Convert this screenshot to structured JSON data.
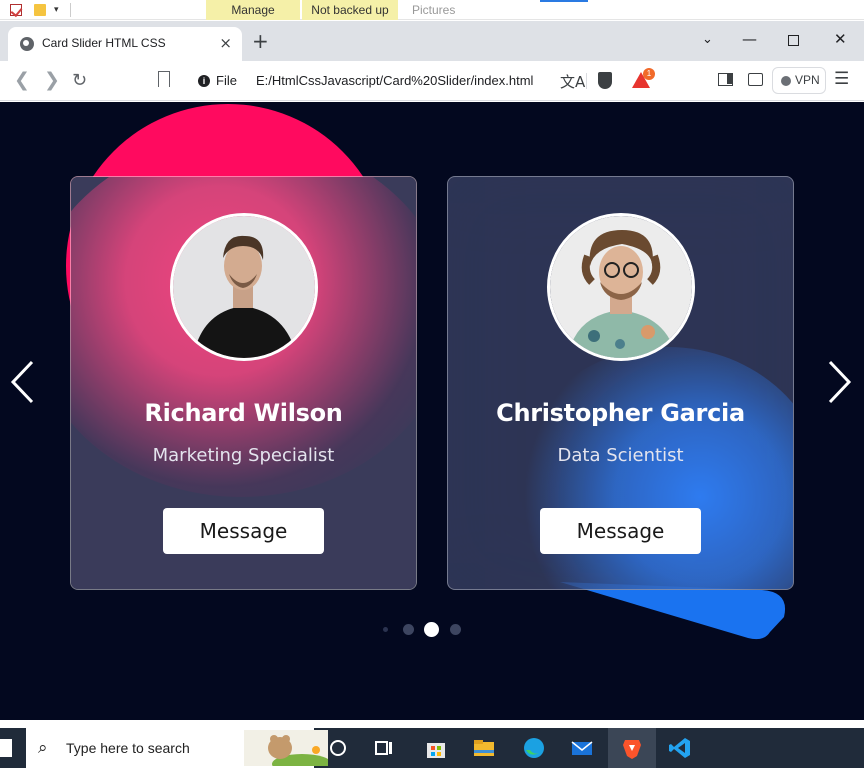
{
  "explorer": {
    "manage_tab": "Manage",
    "not_backed_up_tab": "Not backed up",
    "pictures_label": "Pictures"
  },
  "browser": {
    "tab_title": "Card Slider HTML CSS",
    "tab_close": "×",
    "new_tab": "+",
    "address_scheme_label": "File",
    "address_url": "E:/HtmlCssJavascript/Card%20Slider/index.html",
    "rewards_badge": "1",
    "vpn_label": "VPN",
    "icons": [
      "globe-icon",
      "close-icon",
      "plus-icon",
      "chevron-down-icon",
      "minimize-icon",
      "maximize-icon",
      "back-icon",
      "forward-icon",
      "reload-icon",
      "bookmark-icon",
      "info-icon",
      "translate-icon",
      "brave-shield-icon",
      "brave-rewards-icon",
      "sidebar-icon",
      "wallet-icon",
      "menu-icon"
    ]
  },
  "slider": {
    "cards": [
      {
        "name": "Richard Wilson",
        "role": "Marketing Specialist",
        "button_label": "Message"
      },
      {
        "name": "Christopher Garcia",
        "role": "Data Scientist",
        "button_label": "Message"
      }
    ],
    "pagination": {
      "count": 4,
      "active_index": 2
    },
    "colors": {
      "background": "#03081f",
      "pink_accent": "#ff0a5f",
      "blue_accent": "#1a73f0"
    }
  },
  "taskbar": {
    "search_placeholder": "Type here to search",
    "icons": [
      "windows-start-icon",
      "search-icon",
      "cortana-icon",
      "task-view-icon",
      "microsoft-store-icon",
      "file-explorer-icon",
      "edge-icon",
      "mail-icon",
      "brave-icon",
      "vscode-icon"
    ]
  }
}
